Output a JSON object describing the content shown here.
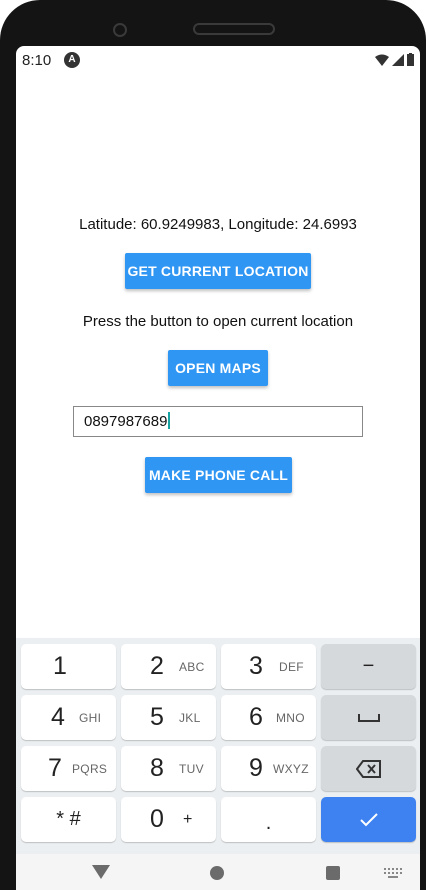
{
  "status_bar": {
    "time": "8:10",
    "app_icon": "A"
  },
  "content": {
    "coordinates": "Latitude: 60.9249983, Longitude: 24.6993",
    "get_location_label": "GET CURRENT LOCATION",
    "hint": "Press the button to open current location",
    "open_maps_label": "OPEN MAPS",
    "phone_value": "0897987689",
    "call_label": "MAKE PHONE CALL"
  },
  "keypad": {
    "k1": {
      "num": "1",
      "letters": ""
    },
    "k2": {
      "num": "2",
      "letters": "ABC"
    },
    "k3": {
      "num": "3",
      "letters": "DEF"
    },
    "k4": {
      "num": "4",
      "letters": "GHI"
    },
    "k5": {
      "num": "5",
      "letters": "JKL"
    },
    "k6": {
      "num": "6",
      "letters": "MNO"
    },
    "k7": {
      "num": "7",
      "letters": "PQRS"
    },
    "k8": {
      "num": "8",
      "letters": "TUV"
    },
    "k9": {
      "num": "9",
      "letters": "WXYZ"
    },
    "star": "* #",
    "k0": {
      "num": "0",
      "letters": "+"
    },
    "dot": ".",
    "minus": "−"
  },
  "colors": {
    "button": "#2f96f3",
    "enter": "#3d82f0",
    "keypad_bg": "#eceff1"
  },
  "icons": [
    "wifi-icon",
    "signal-icon",
    "battery-icon",
    "space-icon",
    "backspace-icon",
    "check-icon",
    "back-icon",
    "home-icon",
    "recents-icon",
    "keyboard-icon"
  ]
}
